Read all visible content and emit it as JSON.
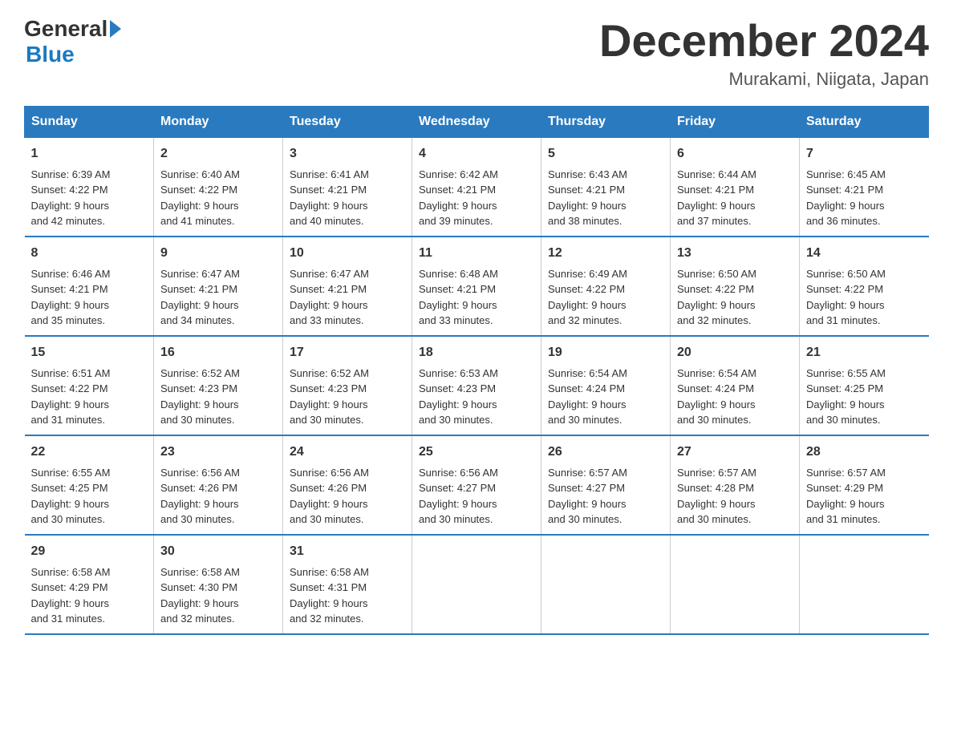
{
  "logo": {
    "general": "General",
    "arrow": "▶",
    "blue": "Blue"
  },
  "title": "December 2024",
  "location": "Murakami, Niigata, Japan",
  "days_of_week": [
    "Sunday",
    "Monday",
    "Tuesday",
    "Wednesday",
    "Thursday",
    "Friday",
    "Saturday"
  ],
  "weeks": [
    [
      {
        "day": "1",
        "sunrise": "6:39 AM",
        "sunset": "4:22 PM",
        "daylight": "9 hours and 42 minutes."
      },
      {
        "day": "2",
        "sunrise": "6:40 AM",
        "sunset": "4:22 PM",
        "daylight": "9 hours and 41 minutes."
      },
      {
        "day": "3",
        "sunrise": "6:41 AM",
        "sunset": "4:21 PM",
        "daylight": "9 hours and 40 minutes."
      },
      {
        "day": "4",
        "sunrise": "6:42 AM",
        "sunset": "4:21 PM",
        "daylight": "9 hours and 39 minutes."
      },
      {
        "day": "5",
        "sunrise": "6:43 AM",
        "sunset": "4:21 PM",
        "daylight": "9 hours and 38 minutes."
      },
      {
        "day": "6",
        "sunrise": "6:44 AM",
        "sunset": "4:21 PM",
        "daylight": "9 hours and 37 minutes."
      },
      {
        "day": "7",
        "sunrise": "6:45 AM",
        "sunset": "4:21 PM",
        "daylight": "9 hours and 36 minutes."
      }
    ],
    [
      {
        "day": "8",
        "sunrise": "6:46 AM",
        "sunset": "4:21 PM",
        "daylight": "9 hours and 35 minutes."
      },
      {
        "day": "9",
        "sunrise": "6:47 AM",
        "sunset": "4:21 PM",
        "daylight": "9 hours and 34 minutes."
      },
      {
        "day": "10",
        "sunrise": "6:47 AM",
        "sunset": "4:21 PM",
        "daylight": "9 hours and 33 minutes."
      },
      {
        "day": "11",
        "sunrise": "6:48 AM",
        "sunset": "4:21 PM",
        "daylight": "9 hours and 33 minutes."
      },
      {
        "day": "12",
        "sunrise": "6:49 AM",
        "sunset": "4:22 PM",
        "daylight": "9 hours and 32 minutes."
      },
      {
        "day": "13",
        "sunrise": "6:50 AM",
        "sunset": "4:22 PM",
        "daylight": "9 hours and 32 minutes."
      },
      {
        "day": "14",
        "sunrise": "6:50 AM",
        "sunset": "4:22 PM",
        "daylight": "9 hours and 31 minutes."
      }
    ],
    [
      {
        "day": "15",
        "sunrise": "6:51 AM",
        "sunset": "4:22 PM",
        "daylight": "9 hours and 31 minutes."
      },
      {
        "day": "16",
        "sunrise": "6:52 AM",
        "sunset": "4:23 PM",
        "daylight": "9 hours and 30 minutes."
      },
      {
        "day": "17",
        "sunrise": "6:52 AM",
        "sunset": "4:23 PM",
        "daylight": "9 hours and 30 minutes."
      },
      {
        "day": "18",
        "sunrise": "6:53 AM",
        "sunset": "4:23 PM",
        "daylight": "9 hours and 30 minutes."
      },
      {
        "day": "19",
        "sunrise": "6:54 AM",
        "sunset": "4:24 PM",
        "daylight": "9 hours and 30 minutes."
      },
      {
        "day": "20",
        "sunrise": "6:54 AM",
        "sunset": "4:24 PM",
        "daylight": "9 hours and 30 minutes."
      },
      {
        "day": "21",
        "sunrise": "6:55 AM",
        "sunset": "4:25 PM",
        "daylight": "9 hours and 30 minutes."
      }
    ],
    [
      {
        "day": "22",
        "sunrise": "6:55 AM",
        "sunset": "4:25 PM",
        "daylight": "9 hours and 30 minutes."
      },
      {
        "day": "23",
        "sunrise": "6:56 AM",
        "sunset": "4:26 PM",
        "daylight": "9 hours and 30 minutes."
      },
      {
        "day": "24",
        "sunrise": "6:56 AM",
        "sunset": "4:26 PM",
        "daylight": "9 hours and 30 minutes."
      },
      {
        "day": "25",
        "sunrise": "6:56 AM",
        "sunset": "4:27 PM",
        "daylight": "9 hours and 30 minutes."
      },
      {
        "day": "26",
        "sunrise": "6:57 AM",
        "sunset": "4:27 PM",
        "daylight": "9 hours and 30 minutes."
      },
      {
        "day": "27",
        "sunrise": "6:57 AM",
        "sunset": "4:28 PM",
        "daylight": "9 hours and 30 minutes."
      },
      {
        "day": "28",
        "sunrise": "6:57 AM",
        "sunset": "4:29 PM",
        "daylight": "9 hours and 31 minutes."
      }
    ],
    [
      {
        "day": "29",
        "sunrise": "6:58 AM",
        "sunset": "4:29 PM",
        "daylight": "9 hours and 31 minutes."
      },
      {
        "day": "30",
        "sunrise": "6:58 AM",
        "sunset": "4:30 PM",
        "daylight": "9 hours and 32 minutes."
      },
      {
        "day": "31",
        "sunrise": "6:58 AM",
        "sunset": "4:31 PM",
        "daylight": "9 hours and 32 minutes."
      },
      null,
      null,
      null,
      null
    ]
  ]
}
